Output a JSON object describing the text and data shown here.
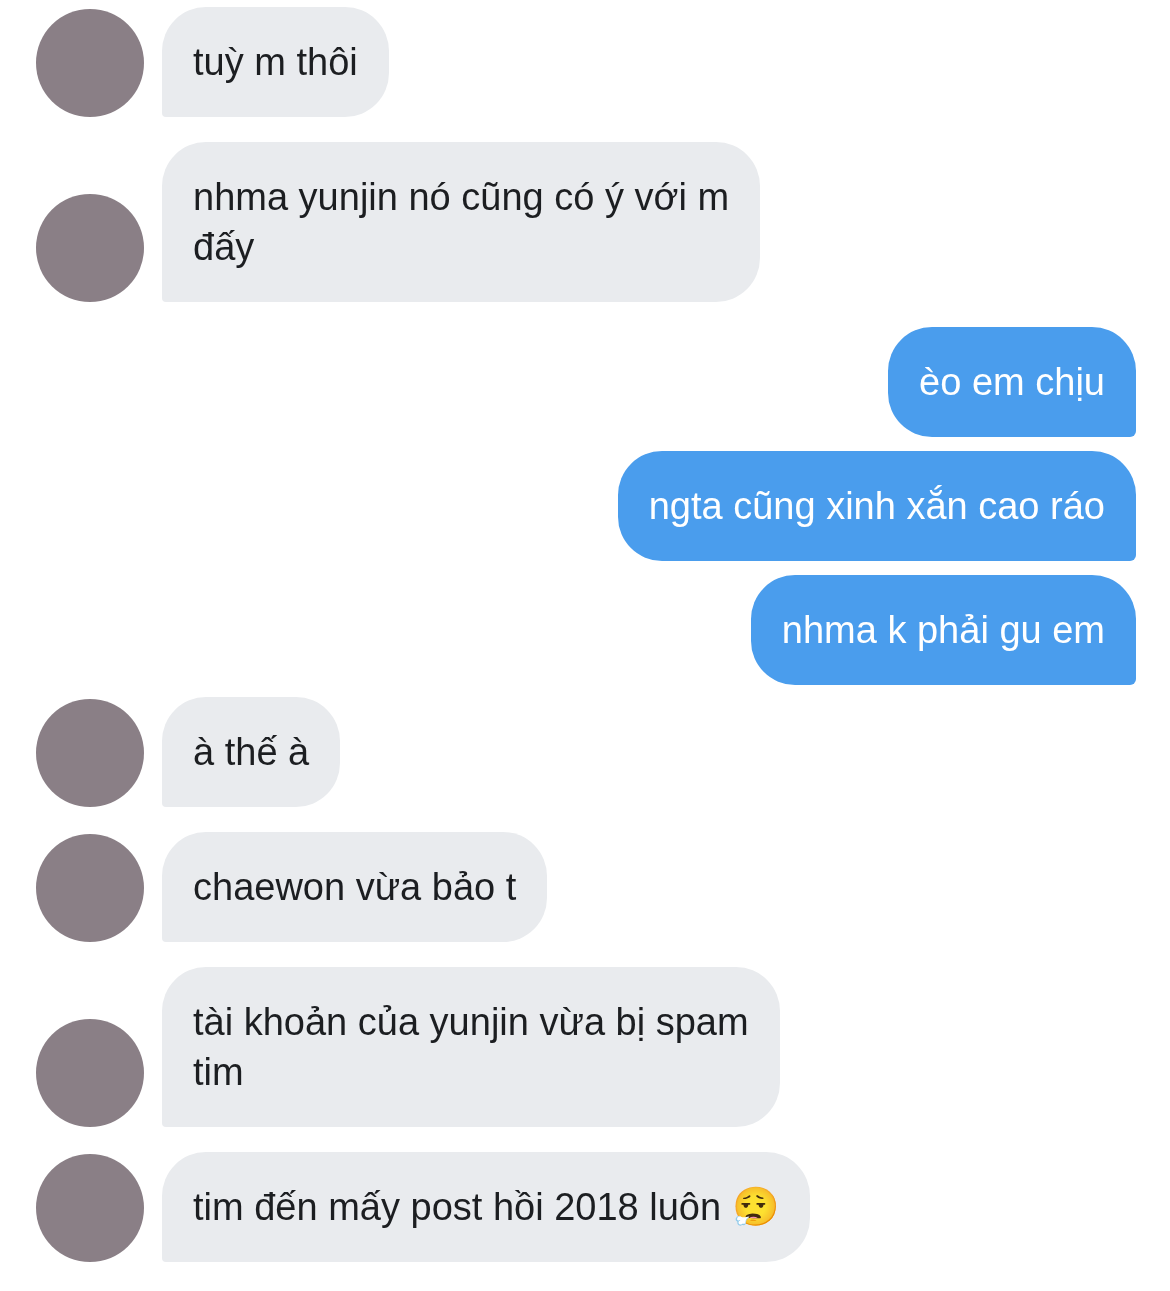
{
  "messages": [
    {
      "kind": "incoming",
      "lines": [
        "tuỳ m thôi"
      ]
    },
    {
      "kind": "incoming",
      "lines": [
        "nhma yunjin nó cũng có ý với m",
        "đấy"
      ]
    },
    {
      "kind": "outgoing",
      "lines": [
        "èo em chịu"
      ]
    },
    {
      "kind": "outgoing",
      "lines": [
        "ngta cũng xinh xắn cao ráo"
      ]
    },
    {
      "kind": "outgoing",
      "lines": [
        "nhma k phải gu em"
      ]
    },
    {
      "kind": "incoming",
      "lines": [
        "à thế à"
      ]
    },
    {
      "kind": "incoming",
      "lines": [
        "chaewon vừa bảo t"
      ]
    },
    {
      "kind": "incoming",
      "lines": [
        "tài khoản của yunjin vừa bị spam",
        "tim"
      ]
    },
    {
      "kind": "incoming",
      "lines": [
        "tim đến mấy post hồi 2018 luôn 😮‍💨"
      ]
    }
  ]
}
